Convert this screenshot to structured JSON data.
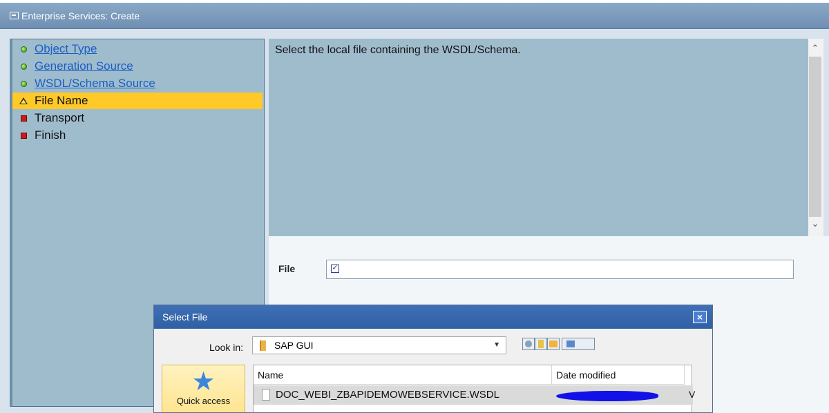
{
  "window": {
    "title": "Enterprise Services: Create"
  },
  "steps": [
    {
      "label": "Object Type",
      "status": "complete",
      "style": "link"
    },
    {
      "label": "Generation Source",
      "status": "complete",
      "style": "link"
    },
    {
      "label": "WSDL/Schema Source",
      "status": "complete",
      "style": "link"
    },
    {
      "label": "File Name",
      "status": "current",
      "style": "plain"
    },
    {
      "label": "Transport",
      "status": "pending",
      "style": "plain"
    },
    {
      "label": "Finish",
      "status": "pending",
      "style": "plain"
    }
  ],
  "description": {
    "text": "Select the local file containing the WSDL/Schema."
  },
  "form": {
    "file_label": "File",
    "file_value": ""
  },
  "dialog": {
    "title": "Select File",
    "look_in_label": "Look in:",
    "look_in_value": "SAP GUI",
    "quick_access_label": "Quick access",
    "columns": [
      "Name",
      "Date modified"
    ],
    "files": [
      {
        "name": "DOC_WEBI_ZBAPIDEMOWEBSERVICE.WSDL",
        "trailing": "V"
      }
    ]
  },
  "colors": {
    "titlebar": "#7f9ebf",
    "panel": "#9fbccd",
    "active_step": "#ffc928",
    "link": "#1b5fc4",
    "dialog_title": "#3566ad"
  }
}
